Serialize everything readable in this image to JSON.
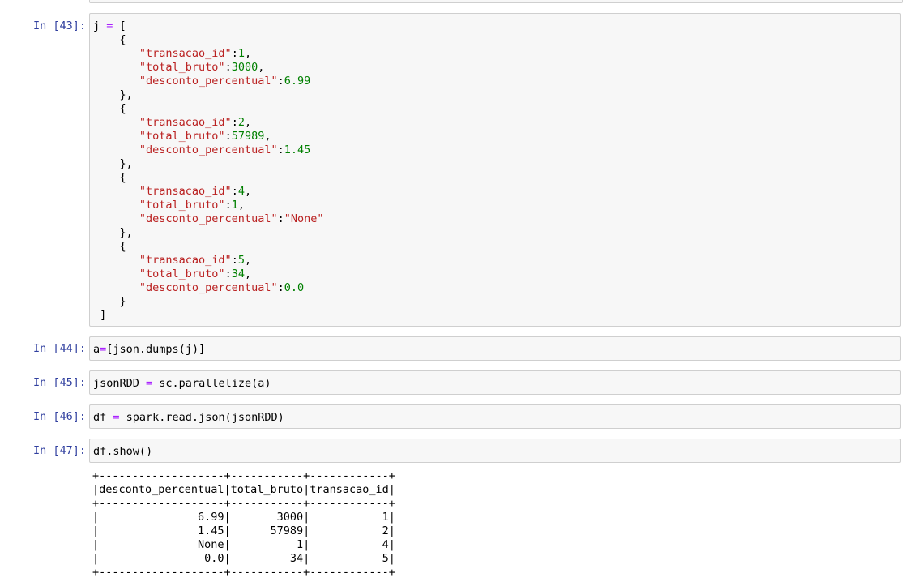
{
  "cells": [
    {
      "prompt": "In [43]:",
      "lines": [
        [
          "j ",
          "=",
          " ["
        ],
        [
          "    {"
        ],
        [
          "       \"transacao_id\"",
          ":",
          "1",
          ","
        ],
        [
          "       \"total_bruto\"",
          ":",
          "3000",
          ","
        ],
        [
          "       \"desconto_percentual\"",
          ":",
          "6.99"
        ],
        [
          "    },"
        ],
        [
          "    {"
        ],
        [
          "       \"transacao_id\"",
          ":",
          "2",
          ","
        ],
        [
          "       \"total_bruto\"",
          ":",
          "57989",
          ","
        ],
        [
          "       \"desconto_percentual\"",
          ":",
          "1.45"
        ],
        [
          "    },"
        ],
        [
          "    {"
        ],
        [
          "       \"transacao_id\"",
          ":",
          "4",
          ","
        ],
        [
          "       \"total_bruto\"",
          ":",
          "1",
          ","
        ],
        [
          "       \"desconto_percentual\"",
          ":",
          "\"None\""
        ],
        [
          "    },"
        ],
        [
          "    {"
        ],
        [
          "       \"transacao_id\"",
          ":",
          "5",
          ","
        ],
        [
          "       \"total_bruto\"",
          ":",
          "34",
          ","
        ],
        [
          "       \"desconto_percentual\"",
          ":",
          "0.0"
        ],
        [
          "    }"
        ],
        [
          " ]"
        ]
      ]
    },
    {
      "prompt": "In [44]:",
      "code_parts": [
        "a",
        "=",
        "[json.dumps(j)]"
      ]
    },
    {
      "prompt": "In [45]:",
      "code_parts": [
        "jsonRDD ",
        "=",
        " sc.parallelize(a)"
      ]
    },
    {
      "prompt": "In [46]:",
      "code_parts": [
        "df ",
        "=",
        " spark.read.json(jsonRDD)"
      ]
    },
    {
      "prompt": "In [47]:",
      "code_parts": [
        "df.show()",
        "",
        ""
      ]
    }
  ],
  "output_text": "+-------------------+-----------+------------+\n|desconto_percentual|total_bruto|transacao_id|\n+-------------------+-----------+------------+\n|               6.99|       3000|           1|\n|               1.45|      57989|           2|\n|               None|          1|           4|\n|                0.0|         34|           5|\n+-------------------+-----------+------------+"
}
